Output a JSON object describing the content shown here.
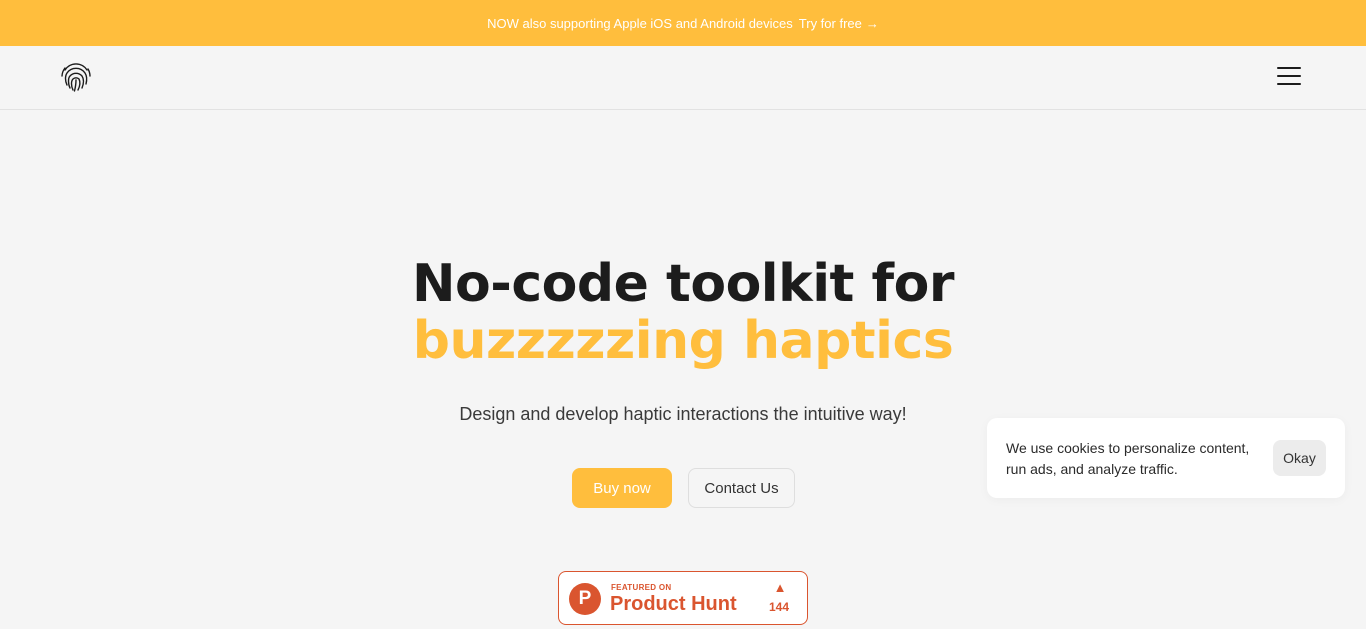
{
  "banner": {
    "message": "NOW also supporting Apple iOS and Android devices",
    "cta_label": "Try for free",
    "cta_arrow": "→",
    "background": "#ffbe3d"
  },
  "navbar": {
    "logo_icon": "fingerprint-icon",
    "menu_icon": "hamburger-menu-icon"
  },
  "hero": {
    "headline_line1": "No-code toolkit for",
    "headline_line2": "buzzzzzing haptics",
    "subtitle": "Design and develop haptic interactions the intuitive way!",
    "buy_label": "Buy now",
    "contact_label": "Contact Us",
    "accent_color": "#ffbe3d"
  },
  "product_hunt": {
    "featured_label": "FEATURED ON",
    "name": "Product Hunt",
    "logo_letter": "P",
    "upvote_icon": "triangle-up-icon",
    "upvotes": "144",
    "brand_color": "#da552f"
  },
  "cookie_banner": {
    "text": "We use cookies to personalize content, run ads, and analyze traffic.",
    "button_label": "Okay"
  }
}
